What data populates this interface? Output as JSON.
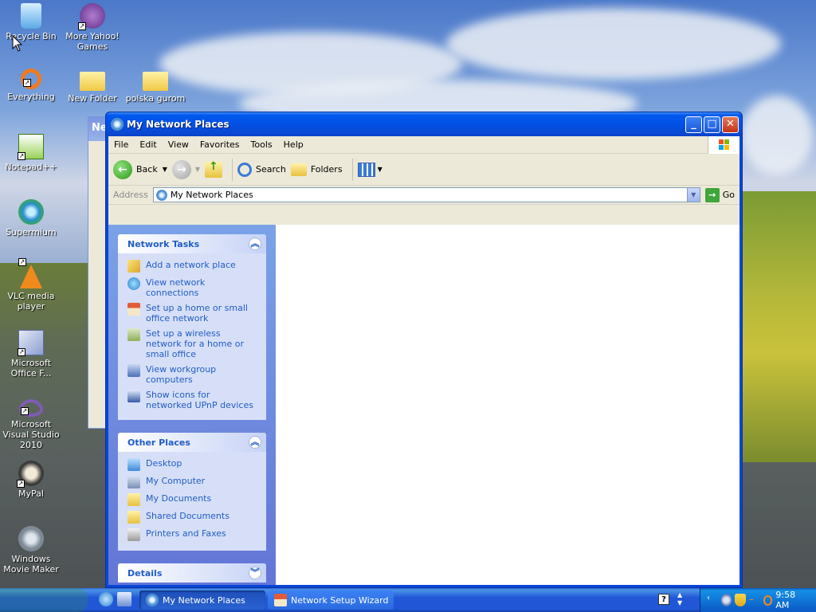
{
  "desktop": {
    "icons": [
      {
        "label": "Recycle Bin",
        "icon": "recycle-bin-icon"
      },
      {
        "label": "More Yahoo! Games",
        "icon": "yahoo-games-icon"
      },
      {
        "label": "Everything",
        "icon": "everything-icon"
      },
      {
        "label": "New Folder",
        "icon": "folder-icon"
      },
      {
        "label": "polska gurom",
        "icon": "folder-icon"
      },
      {
        "label": "Notepad++",
        "icon": "notepadpp-icon"
      },
      {
        "label": "Supermium",
        "icon": "supermium-icon"
      },
      {
        "label": "VLC media player",
        "icon": "vlc-icon"
      },
      {
        "label": "Microsoft Office F...",
        "icon": "office-icon"
      },
      {
        "label": "Microsoft Visual Studio 2010",
        "icon": "visual-studio-icon"
      },
      {
        "label": "MyPal",
        "icon": "mypal-icon"
      },
      {
        "label": "Windows Movie Maker",
        "icon": "movie-maker-icon"
      }
    ]
  },
  "bg_window": {
    "title_fragment": "Ne"
  },
  "window": {
    "title": "My Network Places",
    "menu": [
      "File",
      "Edit",
      "View",
      "Favorites",
      "Tools",
      "Help"
    ],
    "toolbar": {
      "back": "Back",
      "search": "Search",
      "folders": "Folders"
    },
    "address": {
      "label": "Address",
      "value": "My Network Places",
      "go": "Go"
    },
    "network_tasks": {
      "title": "Network Tasks",
      "items": [
        "Add a network place",
        "View network connections",
        "Set up a home or small office network",
        "Set up a wireless network for a home or small office",
        "View workgroup computers",
        "Show icons for networked UPnP devices"
      ]
    },
    "other_places": {
      "title": "Other Places",
      "items": [
        "Desktop",
        "My Computer",
        "My Documents",
        "Shared Documents",
        "Printers and Faxes"
      ]
    },
    "details": {
      "title": "Details"
    }
  },
  "taskbar": {
    "tasks": [
      {
        "label": "My Network Places",
        "active": true
      },
      {
        "label": "Network Setup Wizard",
        "active": false
      }
    ],
    "clock": "9:58 AM"
  }
}
